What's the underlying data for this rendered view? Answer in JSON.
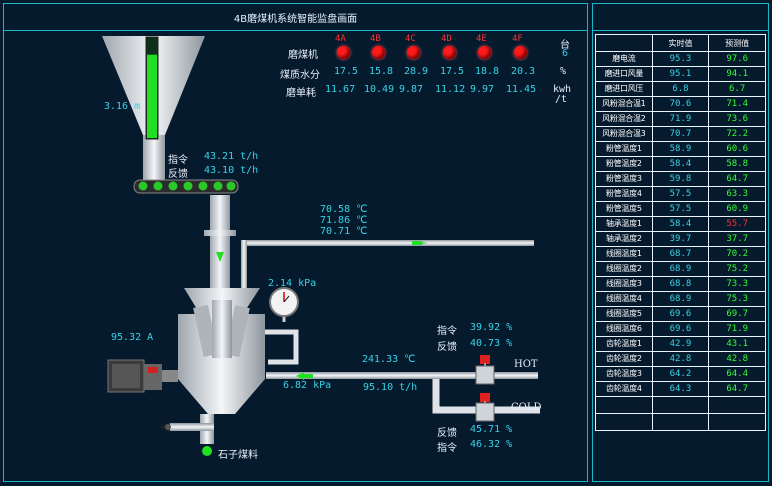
{
  "window": {
    "title": "4B磨煤机系统智能监盘画面"
  },
  "mill_table": {
    "label_mills": "磨煤机",
    "label_moisture": "煤质水分",
    "label_consumption": "磨单耗",
    "mills": [
      "4A",
      "4B",
      "4C",
      "4D",
      "4E",
      "4F"
    ],
    "count_label": "台",
    "count_value": "6",
    "moisture": [
      "17.5",
      "15.8",
      "28.9",
      "17.5",
      "18.8",
      "20.3"
    ],
    "moisture_unit": "%",
    "consumption": [
      "11.67",
      "10.49",
      "9.87",
      "11.12",
      "9.97",
      "11.45"
    ],
    "consumption_unit_top": "kwh",
    "consumption_unit_bottom": "/t",
    "status_color": "#ff1a1a"
  },
  "hopper": {
    "level": "3.16 m",
    "level_fraction": 0.85
  },
  "feeder": {
    "cmd_label": "指令",
    "cmd_value": "43.21 t/h",
    "fb_label": "反馈",
    "fb_value": "43.10 t/h"
  },
  "outlet_temps": [
    "70.58 ℃",
    "71.86 ℃",
    "70.71 ℃"
  ],
  "mill_pressure": "2.14 kPa",
  "mill_current": "95.32 A",
  "hot_air_damper": {
    "cmd_label": "指令",
    "cmd_value": "39.92 %",
    "fb_label": "反馈",
    "fb_value": "40.73 %",
    "label": "HOT"
  },
  "air": {
    "temp": "241.33 ℃",
    "pressure": "6.82 kPa",
    "flow": "95.10 t/h"
  },
  "cold_air_damper": {
    "label": "COLD",
    "fb_label": "反馈",
    "fb_value": "45.71 %",
    "cmd_label": "指令",
    "cmd_value": "46.32 %"
  },
  "stone_coal_label": "石子煤料",
  "monitor_table": {
    "header_realtime": "实时值",
    "header_predicted": "预测值",
    "rows": [
      {
        "name": "磨电流",
        "real": "95.3",
        "pred": "97.6",
        "alarm": false
      },
      {
        "name": "磨进口风量",
        "real": "95.1",
        "pred": "94.1",
        "alarm": false
      },
      {
        "name": "磨进口风压",
        "real": "6.8",
        "pred": "6.7",
        "alarm": false
      },
      {
        "name": "风粉混合温1",
        "real": "70.6",
        "pred": "71.4",
        "alarm": false
      },
      {
        "name": "风粉混合温2",
        "real": "71.9",
        "pred": "73.6",
        "alarm": false
      },
      {
        "name": "风粉混合温3",
        "real": "70.7",
        "pred": "72.2",
        "alarm": false
      },
      {
        "name": "粉管温度1",
        "real": "58.9",
        "pred": "60.6",
        "alarm": false
      },
      {
        "name": "粉管温度2",
        "real": "58.4",
        "pred": "58.8",
        "alarm": false
      },
      {
        "name": "粉管温度3",
        "real": "59.8",
        "pred": "64.7",
        "alarm": false
      },
      {
        "name": "粉管温度4",
        "real": "57.5",
        "pred": "63.3",
        "alarm": false
      },
      {
        "name": "粉管温度5",
        "real": "57.5",
        "pred": "60.9",
        "alarm": false
      },
      {
        "name": "轴承温度1",
        "real": "58.4",
        "pred": "55.7",
        "alarm": true
      },
      {
        "name": "轴承温度2",
        "real": "39.7",
        "pred": "37.7",
        "alarm": false
      },
      {
        "name": "线圈温度1",
        "real": "68.7",
        "pred": "70.2",
        "alarm": false
      },
      {
        "name": "线圈温度2",
        "real": "68.9",
        "pred": "75.2",
        "alarm": false
      },
      {
        "name": "线圈温度3",
        "real": "68.8",
        "pred": "73.3",
        "alarm": false
      },
      {
        "name": "线圈温度4",
        "real": "68.9",
        "pred": "75.3",
        "alarm": false
      },
      {
        "name": "线圈温度5",
        "real": "69.6",
        "pred": "69.7",
        "alarm": false
      },
      {
        "name": "线圈温度6",
        "real": "69.6",
        "pred": "71.9",
        "alarm": false
      },
      {
        "name": "齿轮温度1",
        "real": "42.9",
        "pred": "43.1",
        "alarm": false
      },
      {
        "name": "齿轮温度2",
        "real": "42.8",
        "pred": "42.8",
        "alarm": false
      },
      {
        "name": "齿轮温度3",
        "real": "64.2",
        "pred": "64.4",
        "alarm": false
      },
      {
        "name": "齿轮温度4",
        "real": "64.3",
        "pred": "64.7",
        "alarm": false
      }
    ],
    "empty_rows": 2
  },
  "colors": {
    "accent": "#19b6c8",
    "value": "#37d3e6",
    "predicted": "#31ff31",
    "alarm": "#ff3030"
  }
}
